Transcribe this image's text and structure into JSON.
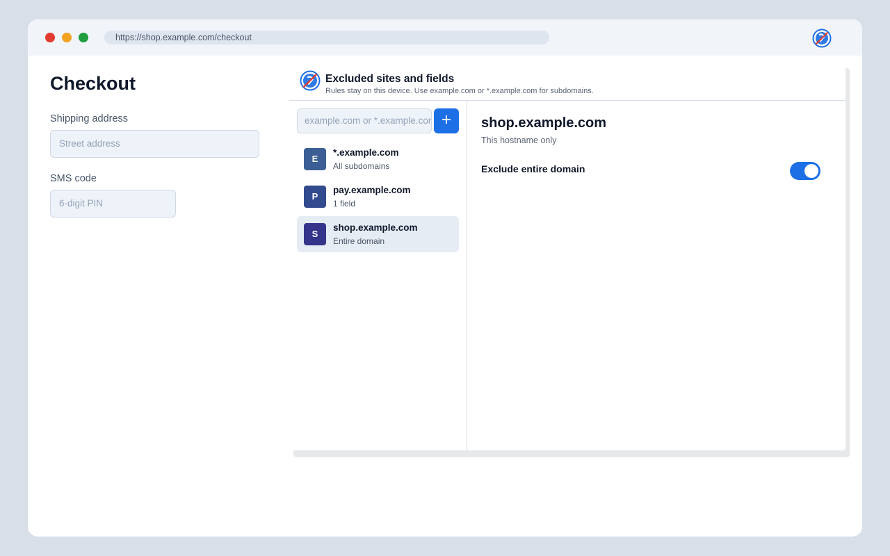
{
  "browser": {
    "url": "https://shop.example.com/checkout",
    "extension_icon": "blocked-autofill-icon"
  },
  "page": {
    "title": "Checkout",
    "fields": [
      {
        "label": "Shipping address",
        "placeholder": "Street address"
      },
      {
        "label": "SMS code",
        "placeholder": "6-digit PIN"
      }
    ]
  },
  "panel": {
    "title": "Excluded sites and fields",
    "subtitle": "Rules stay on this device. Use example.com or *.example.com for subdomains.",
    "input_placeholder": "example.com or *.example.com",
    "add_button": "+",
    "sites": [
      {
        "initial": "E",
        "name": "*.example.com",
        "sub": "All subdomains",
        "color": "#3b5f94",
        "selected": false
      },
      {
        "initial": "P",
        "name": "pay.example.com",
        "sub": "1 field",
        "color": "#324b8f",
        "selected": false
      },
      {
        "initial": "S",
        "name": "shop.example.com",
        "sub": "Entire domain",
        "color": "#33348a",
        "selected": true
      }
    ],
    "detail": {
      "title": "shop.example.com",
      "subtitle": "This hostname only",
      "setting_label": "Exclude entire domain",
      "setting_on": true
    }
  },
  "colors": {
    "accent": "#1d6fe6",
    "selected_row": "#e6ecf4"
  }
}
